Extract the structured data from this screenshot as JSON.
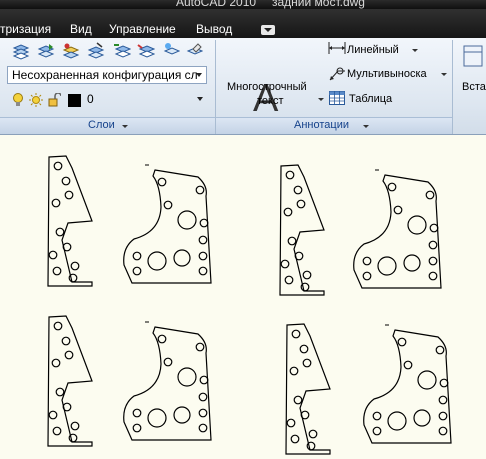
{
  "window": {
    "app_title": "AutoCAD 2010",
    "file_name": "задний мост.dwg"
  },
  "menu": [
    "тризация",
    "Вид",
    "Управление",
    "Вывод"
  ],
  "layers_panel": {
    "layer_config": "Несохраненная конфигурация сл",
    "current_layer": "0",
    "footer_label": "Слои"
  },
  "annotation_panel": {
    "mtext_label_line1": "Многострочный",
    "mtext_label_line2": "текст",
    "linear_label": "Линейный",
    "multileader_label": "Мультивыноска",
    "table_label": "Таблица",
    "footer_label": "Аннотации"
  },
  "insert_panel": {
    "partial_label": "Вста"
  },
  "colors": {
    "layer_color_swatch": "#000000",
    "bulb": "#f4d23c",
    "canvas": "#fcfcf0"
  }
}
